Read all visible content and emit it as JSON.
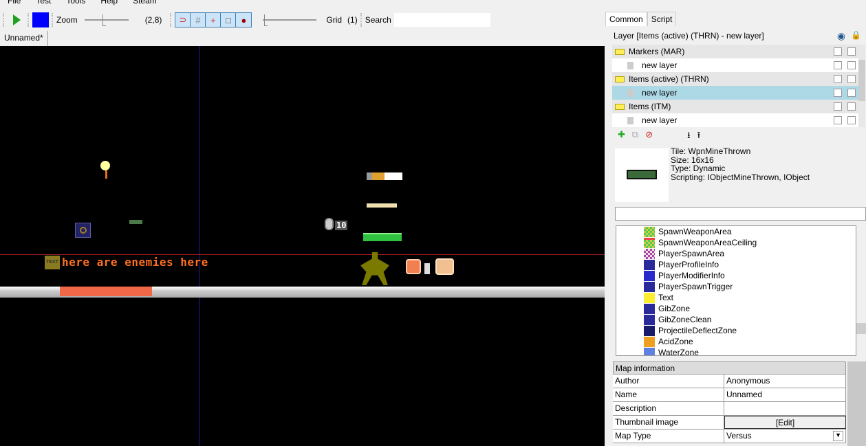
{
  "menu": [
    "File",
    "Test",
    "Tools",
    "Help",
    "Steam"
  ],
  "toolbar": {
    "zoom_label": "Zoom",
    "zoom_value": "(2,8)",
    "grid_label": "Grid",
    "grid_value": "(1)",
    "search_label": "Search",
    "search_value": "",
    "color": "#0000ff"
  },
  "doc_tab": "Unnamed*",
  "canvas": {
    "text_object": "here are enemies here",
    "ammo_count": "10"
  },
  "panel": {
    "tabs": [
      "Common",
      "Script"
    ],
    "layer_header": "Layer [Items (active) (THRN) - new layer]",
    "layers": [
      {
        "label": "Markers (MAR)",
        "type": "group"
      },
      {
        "label": "new layer",
        "type": "layer"
      },
      {
        "label": "Items (active) (THRN)",
        "type": "group"
      },
      {
        "label": "new layer",
        "type": "layer",
        "selected": true
      },
      {
        "label": "Items (ITM)",
        "type": "group"
      },
      {
        "label": "new layer",
        "type": "layer"
      }
    ],
    "tile": {
      "title": "Tile:  WpnMineThrown",
      "size": "Size:  16x16",
      "type": "Type:  Dynamic",
      "scripting": "Scripting:  IObjectMineThrown, IObject"
    },
    "filter_value": "",
    "tree": [
      "SpawnWeaponArea",
      "SpawnWeaponAreaCeiling",
      "PlayerSpawnArea",
      "PlayerProfileInfo",
      "PlayerModifierInfo",
      "PlayerSpawnTrigger",
      "Text",
      "GibZone",
      "GibZoneClean",
      "ProjectileDeflectZone",
      "AcidZone",
      "WaterZone"
    ],
    "map_info": {
      "header": "Map information",
      "rows": [
        {
          "key": "Author",
          "value": "Anonymous"
        },
        {
          "key": "Name",
          "value": "Unnamed"
        },
        {
          "key": "Description",
          "value": ""
        },
        {
          "key": "Thumbnail image",
          "value": "[Edit]"
        },
        {
          "key": "Map Type",
          "value": "Versus"
        }
      ]
    }
  }
}
